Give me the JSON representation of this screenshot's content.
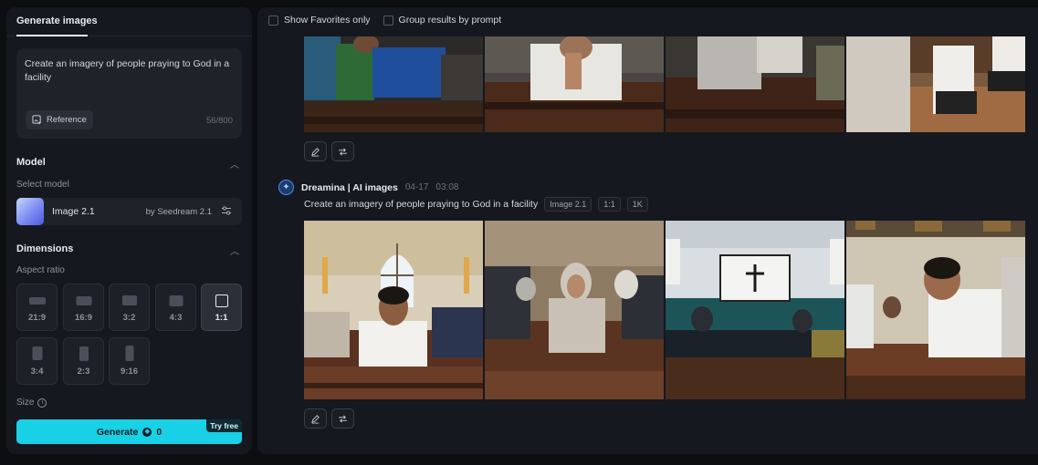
{
  "left_panel": {
    "tab": "Generate images",
    "prompt": "Create an imagery of people praying to God in a facility",
    "reference_label": "Reference",
    "char_count": "56/800",
    "model": {
      "section": "Model",
      "select_label": "Select model",
      "name": "Image 2.1",
      "by": "by Seedream 2.1"
    },
    "dimensions": {
      "section": "Dimensions",
      "aspect_label": "Aspect ratio",
      "ratios": [
        "21:9",
        "16:9",
        "3:2",
        "4:3",
        "1:1",
        "3:4",
        "2:3",
        "9:16"
      ],
      "selected": "1:1"
    },
    "size_label": "Size",
    "generate": {
      "label": "Generate",
      "cost": "0",
      "badge": "Try free"
    }
  },
  "right_panel": {
    "filters": [
      "Show Favorites only",
      "Group results by prompt"
    ],
    "generation": {
      "author": "Dreamina | AI images",
      "date": "04-17",
      "time": "03:08",
      "prompt": "Create an imagery of people praying to God in a facility",
      "tags": [
        "Image 2.1",
        "1:1",
        "1K"
      ]
    }
  },
  "colors": {
    "accent": "#19d1e6",
    "panel": "#15181e",
    "background": "#0c0e12"
  }
}
